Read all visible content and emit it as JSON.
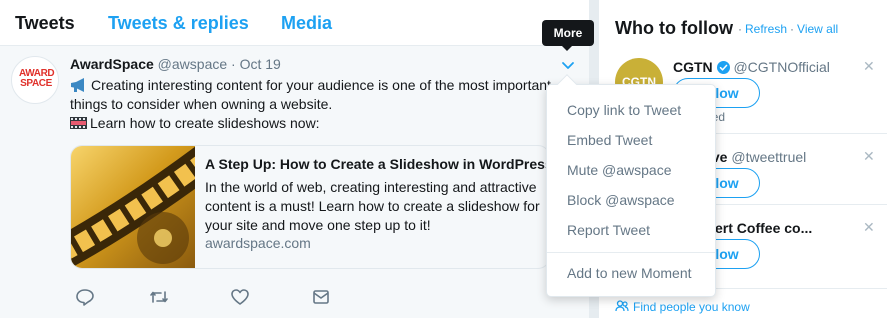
{
  "tabs": [
    {
      "label": "Tweets"
    },
    {
      "label": "Tweets & replies"
    },
    {
      "label": "Media"
    }
  ],
  "tweet": {
    "avatar_text": "AWARD SPACE",
    "name": "AwardSpace",
    "handle": "@awspace",
    "separator": "·",
    "date": "Oct 19",
    "line1": "Creating interesting content for your audience is one of the most important",
    "line2": "things to consider when owning a website.",
    "line3": "Learn how to create slideshows now:",
    "card": {
      "title": "A Step Up: How to Create a Slideshow in WordPress",
      "description": "In the world of web, creating interesting and attractive content is a must! Learn how to create a slideshow for your site and move one step up to it!",
      "domain": "awardspace.com"
    }
  },
  "tooltip": "More",
  "menu": {
    "items": [
      "Copy link to Tweet",
      "Embed Tweet",
      "Mute @awspace",
      "Block @awspace",
      "Report Tweet",
      "Add to new Moment"
    ]
  },
  "sidebar": {
    "title": "Who to follow",
    "refresh": "Refresh",
    "view_all": "View all",
    "dot": "·",
    "accounts": [
      {
        "avatar_text": "CGTN",
        "name": "CGTN",
        "handle": "@CGTNOfficial",
        "follow": "Follow",
        "promoted": "Promoted"
      },
      {
        "name": "truelove",
        "handle": "@tweettruel",
        "follow": "Follow"
      },
      {
        "name": "f Dessert Coffee co...",
        "follow": "Follow"
      }
    ],
    "find_people": "Find people you know"
  },
  "colors": {
    "accent": "#1da1f2",
    "text": "#14171a",
    "muted": "#657786",
    "background": "#e6ecf0"
  }
}
